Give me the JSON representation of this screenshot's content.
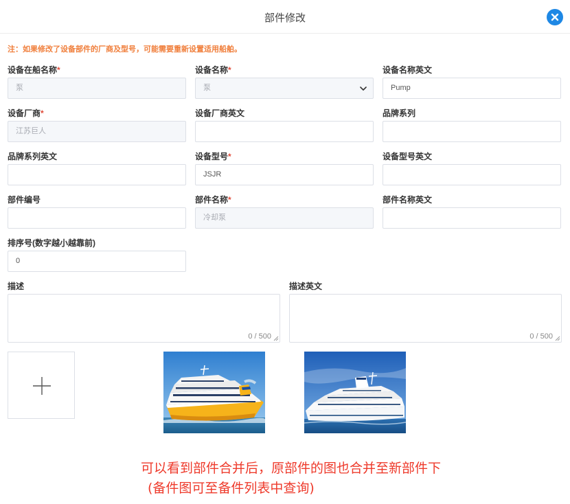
{
  "dialog": {
    "title": "部件修改",
    "note": "注：如果修改了设备部件的厂商及型号，可能需要重新设置适用船舶。"
  },
  "fields": {
    "ship_device_name": {
      "label": "设备在船名称",
      "required": true,
      "value": "泵"
    },
    "device_name": {
      "label": "设备名称",
      "required": true,
      "value": "泵"
    },
    "device_name_en": {
      "label": "设备名称英文",
      "value": "Pump"
    },
    "manufacturer": {
      "label": "设备厂商",
      "required": true,
      "value": "江苏巨人"
    },
    "manufacturer_en": {
      "label": "设备厂商英文",
      "value": ""
    },
    "brand_series": {
      "label": "品牌系列",
      "value": ""
    },
    "brand_series_en": {
      "label": "品牌系列英文",
      "value": ""
    },
    "model": {
      "label": "设备型号",
      "required": true,
      "value": "JSJR"
    },
    "model_en": {
      "label": "设备型号英文",
      "value": ""
    },
    "part_number": {
      "label": "部件编号",
      "value": ""
    },
    "part_name": {
      "label": "部件名称",
      "required": true,
      "value": "冷却泵"
    },
    "part_name_en": {
      "label": "部件名称英文",
      "value": ""
    },
    "sort_order": {
      "label": "排序号(数字越小越靠前)",
      "value": "0"
    },
    "description": {
      "label": "描述",
      "counter": "0 / 500"
    },
    "description_en": {
      "label": "描述英文",
      "counter": "0 / 500"
    }
  },
  "required_mark": "*",
  "images": [
    {
      "name": "yellow-ferry-photo"
    },
    {
      "name": "white-cruise-ship-photo"
    }
  ],
  "annotation": {
    "line1": "可以看到部件合并后，原部件的图也合并至新部件下",
    "line2": "(备件图可至备件列表中查询)"
  },
  "colors": {
    "note": "#f07f3c",
    "required": "#e04b3a",
    "close_button": "#1e88e5",
    "annotation": "#ee3a2b",
    "disabled_bg": "#f5f7fa"
  }
}
